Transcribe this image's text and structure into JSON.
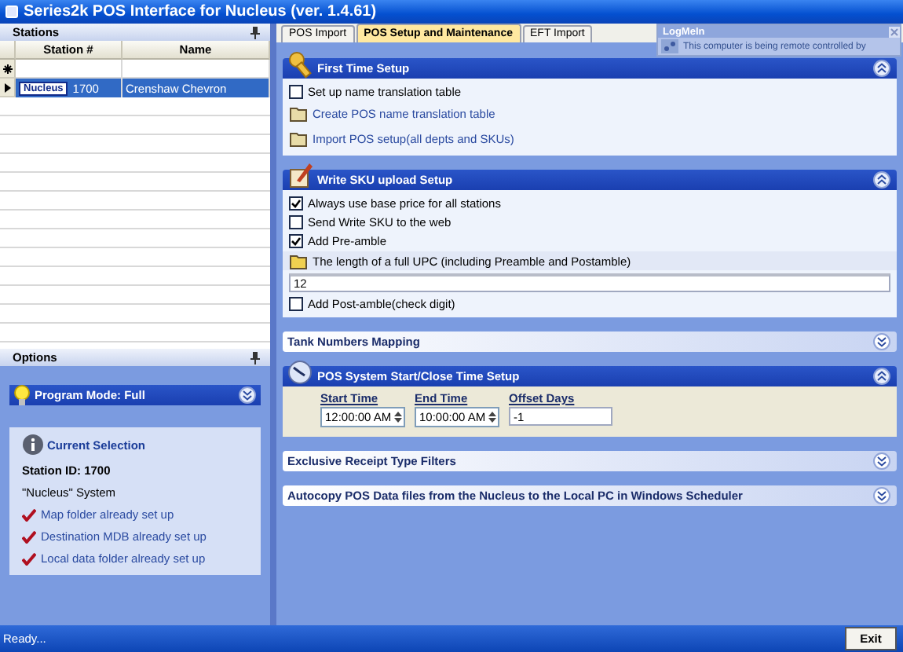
{
  "window": {
    "title": "Series2k POS Interface for Nucleus (ver. 1.4.61)"
  },
  "stations": {
    "title": "Stations",
    "columns": [
      "Station #",
      "Name"
    ],
    "rows": [
      {
        "type": "Nucleus",
        "station": "1700",
        "name": "Crenshaw Chevron",
        "selected": true
      }
    ]
  },
  "options": {
    "title": "Options",
    "program_mode": "Program Mode: Full",
    "expanded": false,
    "selection": {
      "title": "Current Selection",
      "station_id": "Station ID: 1700",
      "system": "\"Nucleus\" System",
      "checks": [
        "Map folder already set up",
        "Destination MDB already set up",
        "Local data folder already set up"
      ]
    }
  },
  "tabs": [
    {
      "label": "POS Import",
      "selected": false
    },
    {
      "label": "POS Setup and Maintenance",
      "selected": true
    },
    {
      "label": "EFT Import",
      "selected": false
    }
  ],
  "sections": [
    {
      "title": "First Time Setup",
      "expanded": true,
      "items": [
        {
          "kind": "checkbox",
          "label": "Set up name translation table",
          "checked": false
        },
        {
          "kind": "link",
          "label": "Create POS name translation table"
        },
        {
          "kind": "link",
          "label": "Import POS setup(all depts and SKUs)"
        }
      ]
    },
    {
      "title": "Write SKU upload Setup",
      "expanded": true,
      "items": [
        {
          "kind": "checkbox",
          "label": "Always use base price for all stations",
          "checked": true
        },
        {
          "kind": "checkbox",
          "label": "Send Write SKU to the web",
          "checked": false
        },
        {
          "kind": "checkbox",
          "label": "Add Pre-amble",
          "checked": true
        },
        {
          "kind": "note",
          "label": "The length of a full UPC (including Preamble and Postamble)"
        },
        {
          "kind": "field",
          "value": "12"
        },
        {
          "kind": "checkbox",
          "label": "Add Post-amble(check digit)",
          "checked": false
        }
      ]
    },
    {
      "title": "Tank Numbers Mapping",
      "expanded": false
    },
    {
      "title": "POS System Start/Close Time Setup",
      "expanded": true,
      "items": [
        {
          "kind": "times",
          "fields": [
            {
              "kind": "time",
              "label": "Start Time",
              "value": "12:00:00 AM"
            },
            {
              "kind": "time",
              "label": "End Time",
              "value": "10:00:00 AM"
            },
            {
              "kind": "number",
              "label": "Offset Days",
              "value": "-1"
            }
          ]
        }
      ]
    },
    {
      "title": "Exclusive Receipt Type Filters",
      "expanded": false
    },
    {
      "title": "Autocopy POS Data files from the Nucleus to the Local PC in Windows Scheduler",
      "expanded": false
    }
  ],
  "notification": {
    "title": "LogMeIn",
    "message": "This computer is being remote controlled by"
  },
  "status_bar": {
    "text": "Ready..."
  },
  "exit_button": "Exit"
}
